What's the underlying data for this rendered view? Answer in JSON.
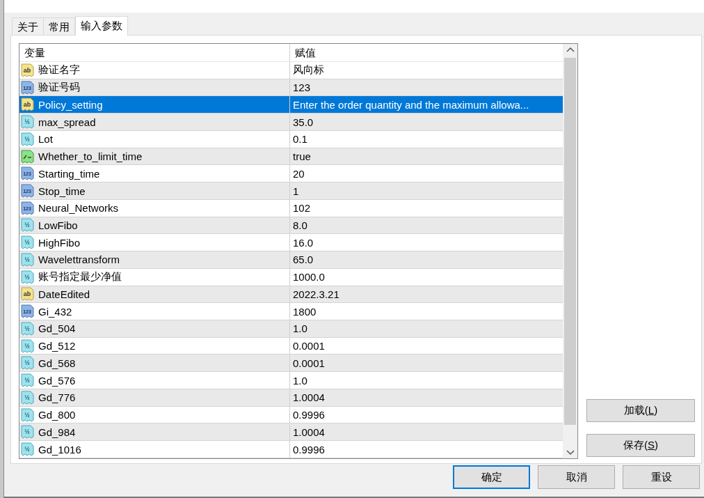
{
  "tabs": [
    {
      "label": "关于",
      "selected": false
    },
    {
      "label": "常用",
      "selected": false
    },
    {
      "label": "输入参数",
      "selected": true
    }
  ],
  "table": {
    "columns": [
      "变量",
      "赋值"
    ],
    "rows": [
      {
        "kind": "string",
        "icon": "ab",
        "name": "验证名字",
        "value": "风向标",
        "selected": false
      },
      {
        "kind": "int",
        "icon": "123",
        "name": "验证号码",
        "value": "123",
        "selected": false
      },
      {
        "kind": "string",
        "icon": "ab",
        "name": "Policy_setting",
        "value": "Enter the order quantity and the maximum allowa...",
        "selected": true
      },
      {
        "kind": "double",
        "icon": "½",
        "name": "max_spread",
        "value": "35.0",
        "selected": false
      },
      {
        "kind": "double",
        "icon": "½",
        "name": "Lot",
        "value": "0.1",
        "selected": false
      },
      {
        "kind": "bool",
        "name": "Whether_to_limit_time",
        "value": "true",
        "selected": false
      },
      {
        "kind": "int",
        "icon": "123",
        "name": "Starting_time",
        "value": "20",
        "selected": false
      },
      {
        "kind": "int",
        "icon": "123",
        "name": "Stop_time",
        "value": "1",
        "selected": false
      },
      {
        "kind": "int",
        "icon": "123",
        "name": "Neural_Networks",
        "value": "102",
        "selected": false
      },
      {
        "kind": "double",
        "icon": "½",
        "name": "LowFibo",
        "value": "8.0",
        "selected": false
      },
      {
        "kind": "double",
        "icon": "½",
        "name": "HighFibo",
        "value": "16.0",
        "selected": false
      },
      {
        "kind": "double",
        "icon": "½",
        "name": "Wavelettransform",
        "value": "65.0",
        "selected": false
      },
      {
        "kind": "double",
        "icon": "½",
        "name": "账号指定最少净值",
        "value": "1000.0",
        "selected": false
      },
      {
        "kind": "string",
        "icon": "ab",
        "name": "DateEdited",
        "value": "2022.3.21",
        "selected": false
      },
      {
        "kind": "int",
        "icon": "123",
        "name": "Gi_432",
        "value": "1800",
        "selected": false
      },
      {
        "kind": "double",
        "icon": "½",
        "name": "Gd_504",
        "value": "1.0",
        "selected": false
      },
      {
        "kind": "double",
        "icon": "½",
        "name": "Gd_512",
        "value": "0.0001",
        "selected": false
      },
      {
        "kind": "double",
        "icon": "½",
        "name": "Gd_568",
        "value": "0.0001",
        "selected": false
      },
      {
        "kind": "double",
        "icon": "½",
        "name": "Gd_576",
        "value": "1.0",
        "selected": false
      },
      {
        "kind": "double",
        "icon": "½",
        "name": "Gd_776",
        "value": "1.0004",
        "selected": false
      },
      {
        "kind": "double",
        "icon": "½",
        "name": "Gd_800",
        "value": "0.9996",
        "selected": false
      },
      {
        "kind": "double",
        "icon": "½",
        "name": "Gd_984",
        "value": "1.0004",
        "selected": false
      },
      {
        "kind": "double",
        "icon": "½",
        "name": "Gd_1016",
        "value": "0.9996",
        "selected": false
      }
    ]
  },
  "side_buttons": [
    "加载(L)",
    "保存(S)"
  ],
  "buttons": [
    {
      "label": "确定",
      "default": true
    },
    {
      "label": "取消",
      "default": false
    },
    {
      "label": "重设",
      "default": false
    }
  ]
}
